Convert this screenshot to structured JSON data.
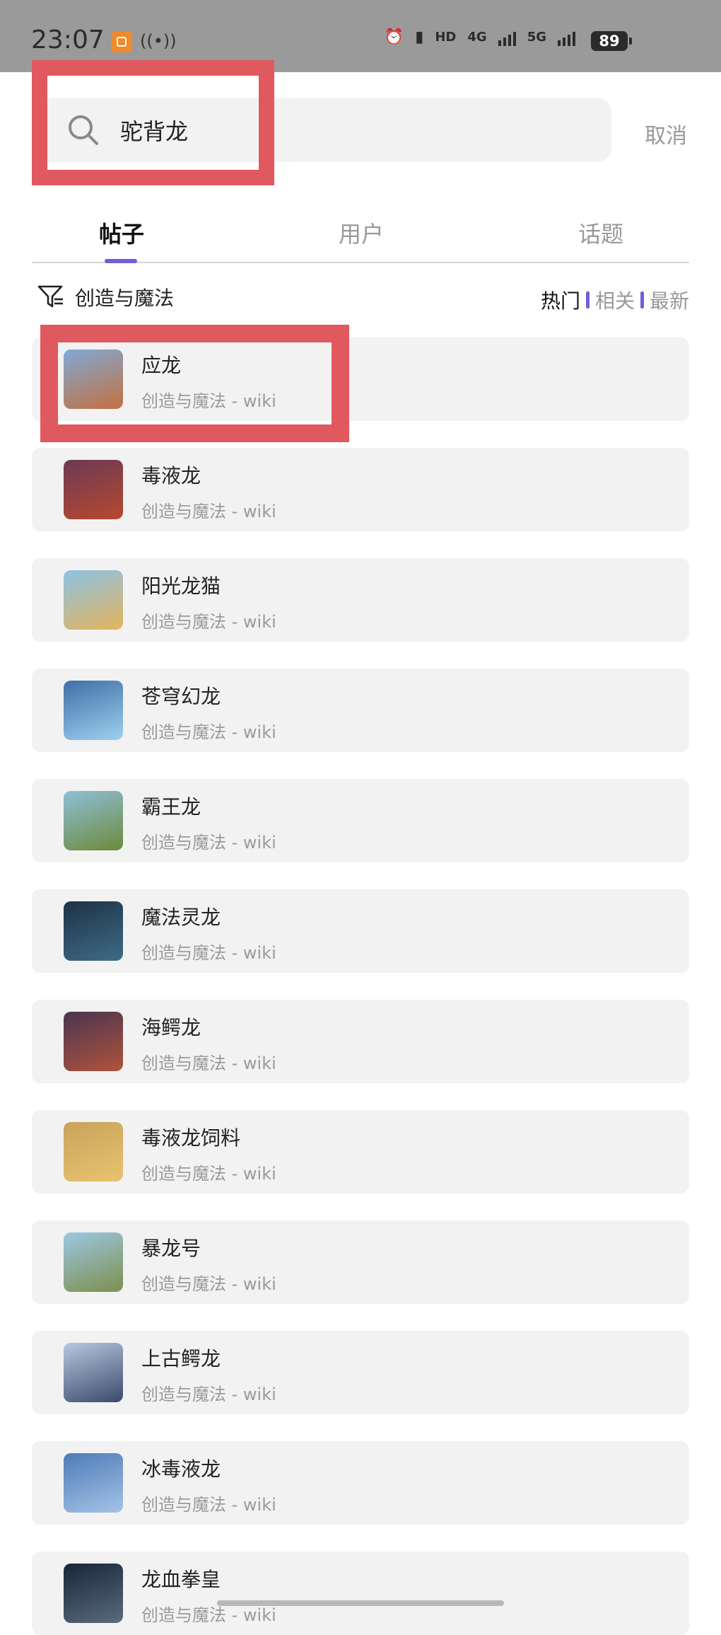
{
  "status": {
    "time": "23:07",
    "network1": "4G",
    "network2": "5G",
    "hd": "HD",
    "battery": "89"
  },
  "search": {
    "query": "驼背龙",
    "cancel": "取消"
  },
  "tabs": [
    {
      "label": "帖子"
    },
    {
      "label": "用户"
    },
    {
      "label": "话题"
    }
  ],
  "filter": {
    "label": "创造与魔法"
  },
  "sort": {
    "hot": "热门",
    "related": "相关",
    "newest": "最新"
  },
  "results": [
    {
      "title": "应龙",
      "sub": "创造与魔法 - wiki",
      "thumb_colors": [
        "#7fa9d6",
        "#c4703f"
      ]
    },
    {
      "title": "毒液龙",
      "sub": "创造与魔法 - wiki",
      "thumb_colors": [
        "#6b3a55",
        "#b8482f"
      ]
    },
    {
      "title": "阳光龙猫",
      "sub": "创造与魔法 - wiki",
      "thumb_colors": [
        "#8cc2e6",
        "#e3b45a"
      ]
    },
    {
      "title": "苍穹幻龙",
      "sub": "创造与魔法 - wiki",
      "thumb_colors": [
        "#3e6fa6",
        "#9fd0f0"
      ]
    },
    {
      "title": "霸王龙",
      "sub": "创造与魔法 - wiki",
      "thumb_colors": [
        "#8fbfd8",
        "#6c8a3a"
      ]
    },
    {
      "title": "魔法灵龙",
      "sub": "创造与魔法 - wiki",
      "thumb_colors": [
        "#1e3246",
        "#3e6c86"
      ]
    },
    {
      "title": "海鳄龙",
      "sub": "创造与魔法 - wiki",
      "thumb_colors": [
        "#4a3550",
        "#b0533c"
      ]
    },
    {
      "title": "毒液龙饲料",
      "sub": "创造与魔法 - wiki",
      "thumb_colors": [
        "#c9a35c",
        "#e8c36e"
      ]
    },
    {
      "title": "暴龙号",
      "sub": "创造与魔法 - wiki",
      "thumb_colors": [
        "#9cc7e2",
        "#7d8f4d"
      ]
    },
    {
      "title": "上古鳄龙",
      "sub": "创造与魔法 - wiki",
      "thumb_colors": [
        "#b7c8e0",
        "#3a4a6a"
      ]
    },
    {
      "title": "冰毒液龙",
      "sub": "创造与魔法 - wiki",
      "thumb_colors": [
        "#4d7bb8",
        "#a5c3e6"
      ]
    },
    {
      "title": "龙血拳皇",
      "sub": "创造与魔法 - wiki",
      "thumb_colors": [
        "#18263a",
        "#5a6b7d"
      ]
    }
  ],
  "accent_color": "#6f5fd8",
  "highlight_color": "#e0595f"
}
